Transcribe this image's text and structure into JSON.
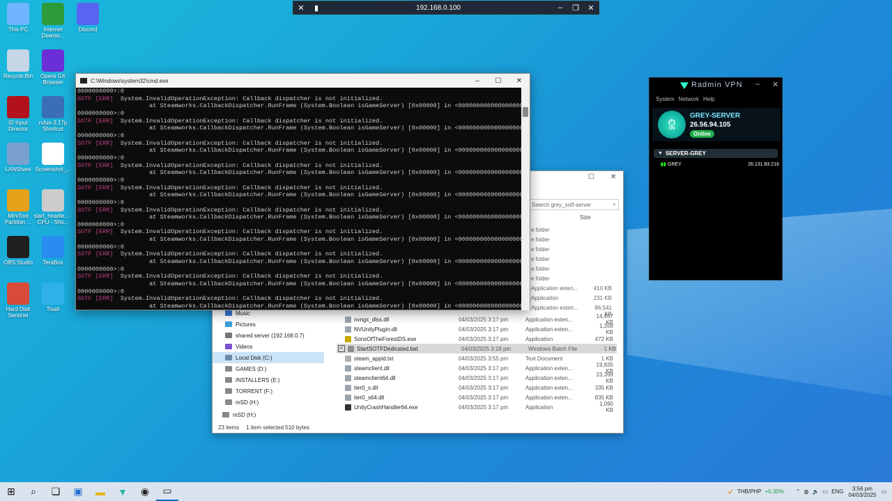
{
  "desktop": {
    "icons": [
      {
        "label": "This PC",
        "icon": "monitor-icon",
        "color": "#6fb5ff"
      },
      {
        "label": "Internet Downlo...",
        "icon": "download-globe-icon",
        "color": "#2e9b3a"
      },
      {
        "label": "Discord",
        "icon": "discord-icon",
        "color": "#5865f2"
      },
      {
        "label": "Recycle Bin",
        "icon": "recycle-bin-icon",
        "color": "#c6d6e6"
      },
      {
        "label": "Opera GX Browser",
        "icon": "opera-icon",
        "color": "#6a2fd6"
      },
      {
        "label": "iD Input Director",
        "icon": "input-director-icon",
        "color": "#b3121c"
      },
      {
        "label": "rufus-3.17p Shortcut",
        "icon": "usb-icon",
        "color": "#3a6fb8"
      },
      {
        "label": "LANShare",
        "icon": "lanshare-icon",
        "color": "#7aa0d0"
      },
      {
        "label": "Screenshot_...",
        "icon": "qr-icon",
        "color": "#ffffff"
      },
      {
        "label": "MiniTool Partition ...",
        "icon": "partition-icon",
        "color": "#e5a21a"
      },
      {
        "label": "start_headle... - CPU - Sho...",
        "icon": "script-icon",
        "color": "#cccccc"
      },
      {
        "label": "OBS Studio",
        "icon": "obs-icon",
        "color": "#202020"
      },
      {
        "label": "TeraBox",
        "icon": "terabox-icon",
        "color": "#2a8cf0"
      },
      {
        "label": "Hard Disk Sentinel",
        "icon": "hdd-icon",
        "color": "#d84a3a"
      },
      {
        "label": "Tixati",
        "icon": "tixati-icon",
        "color": "#2fb0e8"
      }
    ]
  },
  "remote_bar": {
    "address": "192.168.0.100",
    "buttons": [
      "pin-off-icon",
      "signal-icon",
      "minimize-icon",
      "restore-icon",
      "close-icon"
    ]
  },
  "cmd": {
    "title": "C:\\Windows\\system32\\cmd.exe",
    "lines": [
      {
        "tag": "",
        "text": "0000000000>:0"
      },
      {
        "tag": "SOTF [ERR]",
        "text": "  System.InvalidOperationException: Callback dispatcher is not initialized."
      },
      {
        "tag": "",
        "text": "                    at Steamworks.CallbackDispatcher.RunFrame (System.Boolean isGameServer) [0x00000] in <000000000000000000000"
      },
      {
        "tag": "",
        "text": "0000000000>:0"
      },
      {
        "tag": "SOTF [ERR]",
        "text": "  System.InvalidOperationException: Callback dispatcher is not initialized."
      },
      {
        "tag": "",
        "text": "                    at Steamworks.CallbackDispatcher.RunFrame (System.Boolean isGameServer) [0x00000] in <000000000000000000000"
      },
      {
        "tag": "",
        "text": "0000000000>:0"
      },
      {
        "tag": "SOTF [ERR]",
        "text": "  System.InvalidOperationException: Callback dispatcher is not initialized."
      },
      {
        "tag": "",
        "text": "                    at Steamworks.CallbackDispatcher.RunFrame (System.Boolean isGameServer) [0x00000] in <000000000000000000000"
      },
      {
        "tag": "",
        "text": "0000000000>:0"
      },
      {
        "tag": "SOTF [ERR]",
        "text": "  System.InvalidOperationException: Callback dispatcher is not initialized."
      },
      {
        "tag": "",
        "text": "                    at Steamworks.CallbackDispatcher.RunFrame (System.Boolean isGameServer) [0x00000] in <000000000000000000000"
      },
      {
        "tag": "",
        "text": "0000000000>:0"
      },
      {
        "tag": "SOTF [ERR]",
        "text": "  System.InvalidOperationException: Callback dispatcher is not initialized."
      },
      {
        "tag": "",
        "text": "                    at Steamworks.CallbackDispatcher.RunFrame (System.Boolean isGameServer) [0x00000] in <000000000000000000000"
      },
      {
        "tag": "",
        "text": "0000000000>:0"
      },
      {
        "tag": "SOTF [ERR]",
        "text": "  System.InvalidOperationException: Callback dispatcher is not initialized."
      },
      {
        "tag": "",
        "text": "                    at Steamworks.CallbackDispatcher.RunFrame (System.Boolean isGameServer) [0x00000] in <000000000000000000000"
      },
      {
        "tag": "",
        "text": "0000000000>:0"
      },
      {
        "tag": "SOTF [ERR]",
        "text": "  System.InvalidOperationException: Callback dispatcher is not initialized."
      },
      {
        "tag": "",
        "text": "                    at Steamworks.CallbackDispatcher.RunFrame (System.Boolean isGameServer) [0x00000] in <000000000000000000000"
      },
      {
        "tag": "",
        "text": "0000000000>:0"
      },
      {
        "tag": "SOTF [ERR]",
        "text": "  System.InvalidOperationException: Callback dispatcher is not initialized."
      },
      {
        "tag": "",
        "text": "                    at Steamworks.CallbackDispatcher.RunFrame (System.Boolean isGameServer) [0x00000] in <000000000000000000000"
      },
      {
        "tag": "",
        "text": "0000000000>:0"
      },
      {
        "tag": "SOTF [ERR]",
        "text": "  System.InvalidOperationException: Callback dispatcher is not initialized."
      },
      {
        "tag": "",
        "text": "                    at Steamworks.CallbackDispatcher.RunFrame (System.Boolean isGameServer) [0x00000] in <000000000000000000000"
      },
      {
        "tag": "",
        "text": "0000000000>:0"
      },
      {
        "tag": "SOTF [ERR]",
        "text": "  System.InvalidOperationException: Callback dispatcher is not initialized."
      },
      {
        "tag": "",
        "text": "                    at Steamworks.CallbackDispatcher.RunFrame (System.Boolean isGameServer) [0x00000] in <000000000000000000000"
      }
    ]
  },
  "explorer": {
    "search_placeholder": "Search grey_sotf-server",
    "size_header": "Size",
    "nav": [
      {
        "label": "Music",
        "icon": "music-icon",
        "color": "#3b78d8"
      },
      {
        "label": "Pictures",
        "icon": "pictures-icon",
        "color": "#3aa0d8"
      },
      {
        "label": "shared server (192.168.0.7)",
        "icon": "network-drive-icon",
        "color": "#777777"
      },
      {
        "label": "Videos",
        "icon": "videos-icon",
        "color": "#7a4fd0"
      },
      {
        "label": "Local Disk (C:)",
        "icon": "drive-icon",
        "color": "#6a8aa8",
        "selected": true
      },
      {
        "label": "GAMES (D:)",
        "icon": "drive-icon",
        "color": "#888888"
      },
      {
        "label": "INSTALLERS (E:)",
        "icon": "drive-icon",
        "color": "#888888"
      },
      {
        "label": "TORRENT (F:)",
        "icon": "drive-icon",
        "color": "#888888"
      },
      {
        "label": "mSD (H:)",
        "icon": "drive-icon",
        "color": "#888888"
      },
      {
        "label": "mSD (H:)",
        "icon": "drive-icon",
        "color": "#888888"
      }
    ],
    "partial_rows": [
      {
        "type": "e folder",
        "size": ""
      },
      {
        "type": "e folder",
        "size": ""
      },
      {
        "type": "e folder",
        "size": ""
      },
      {
        "type": "e folder",
        "size": ""
      },
      {
        "type": "e folder",
        "size": ""
      },
      {
        "type": "e folder",
        "size": ""
      },
      {
        "type": "Application exten...",
        "size": "410 KB"
      },
      {
        "type": "Application",
        "size": "231 KB"
      },
      {
        "type": "Application exten...",
        "size": "86,541 KB"
      }
    ],
    "files": [
      {
        "name": "nvngx_dlss.dll",
        "date": "04/03/2025 3:17 pm",
        "type": "Application exten...",
        "size": "14,457 KB",
        "icon_color": "#9aa4ae"
      },
      {
        "name": "NVUnityPlugin.dll",
        "date": "04/03/2025 3:17 pm",
        "type": "Application exten...",
        "size": "1,358 KB",
        "icon_color": "#9aa4ae"
      },
      {
        "name": "SonsOfTheForestDS.exe",
        "date": "04/03/2025 3:17 pm",
        "type": "Application",
        "size": "472 KB",
        "icon_color": "#c9a800"
      },
      {
        "name": "StartSOTFDedicated.bat",
        "date": "04/03/2025 3:18 pm",
        "type": "Windows Batch File",
        "size": "1 KB",
        "icon_color": "#8c8c8c",
        "selected": true
      },
      {
        "name": "steam_appid.txt",
        "date": "04/03/2025 3:55 pm",
        "type": "Text Document",
        "size": "1 KB",
        "icon_color": "#b0b0b0"
      },
      {
        "name": "steamclient.dll",
        "date": "04/03/2025 3:17 pm",
        "type": "Application exten...",
        "size": "19,835 KB",
        "icon_color": "#9aa4ae"
      },
      {
        "name": "steamclient64.dll",
        "date": "04/03/2025 3:17 pm",
        "type": "Application exten...",
        "size": "23,399 KB",
        "icon_color": "#9aa4ae"
      },
      {
        "name": "tier0_s.dll",
        "date": "04/03/2025 3:17 pm",
        "type": "Application exten...",
        "size": "335 KB",
        "icon_color": "#9aa4ae"
      },
      {
        "name": "tier0_s64.dll",
        "date": "04/03/2025 3:17 pm",
        "type": "Application exten...",
        "size": "835 KB",
        "icon_color": "#9aa4ae"
      },
      {
        "name": "UnityCrashHandler64.exe",
        "date": "04/03/2025 3:17 pm",
        "type": "Application",
        "size": "1,090 KB",
        "icon_color": "#333333"
      }
    ],
    "status_count": "23 items",
    "status_selection": "1 item selected  510 bytes"
  },
  "radmin": {
    "title": "Radmin VPN",
    "menu": [
      "System",
      "Network",
      "Help"
    ],
    "power_label": "ON",
    "host_name": "GREY-SERVER",
    "host_ip": "26.56.94.105",
    "status": "Online",
    "network_name": "SERVER-GREY",
    "peers": [
      {
        "name": "GREY",
        "ip": "26.131.83.216"
      }
    ]
  },
  "taskbar": {
    "apps": [
      "windows-start-icon",
      "search-icon",
      "task-view-icon",
      "store-icon",
      "file-explorer-icon",
      "radmin-icon",
      "obs-icon",
      "terminal-icon"
    ],
    "ticker_label": "THB/PHP",
    "ticker_value": "+0.30%",
    "language": "ENG",
    "time": "3:56 pm",
    "date": "04/03/2025"
  }
}
